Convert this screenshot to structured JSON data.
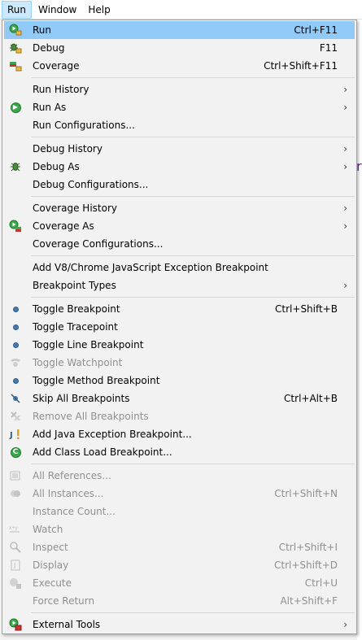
{
  "menubar": {
    "items": [
      {
        "label": "Run"
      },
      {
        "label": "Window"
      },
      {
        "label": "Help"
      }
    ]
  },
  "run_menu": {
    "g1": [
      {
        "label": "Run",
        "accel": "Ctrl+F11",
        "icon": "run-icon"
      },
      {
        "label": "Debug",
        "accel": "F11",
        "icon": "debug-icon"
      },
      {
        "label": "Coverage",
        "accel": "Ctrl+Shift+F11",
        "icon": "coverage-icon"
      }
    ],
    "g2": [
      {
        "label": "Run History"
      },
      {
        "label": "Run As",
        "icon": "run-as-icon"
      },
      {
        "label": "Run Configurations..."
      }
    ],
    "g3": [
      {
        "label": "Debug History"
      },
      {
        "label": "Debug As",
        "icon": "debug-as-icon"
      },
      {
        "label": "Debug Configurations..."
      }
    ],
    "g4": [
      {
        "label": "Coverage History"
      },
      {
        "label": "Coverage As",
        "icon": "coverage-as-icon"
      },
      {
        "label": "Coverage Configurations..."
      }
    ],
    "g5": [
      {
        "label": "Add V8/Chrome JavaScript Exception Breakpoint"
      },
      {
        "label": "Breakpoint Types"
      }
    ],
    "g6": [
      {
        "label": "Toggle Breakpoint",
        "accel": "Ctrl+Shift+B"
      },
      {
        "label": "Toggle Tracepoint"
      },
      {
        "label": "Toggle Line Breakpoint"
      },
      {
        "label": "Toggle Watchpoint"
      },
      {
        "label": "Toggle Method Breakpoint"
      },
      {
        "label": "Skip All Breakpoints",
        "accel": "Ctrl+Alt+B"
      },
      {
        "label": "Remove All Breakpoints"
      },
      {
        "label": "Add Java Exception Breakpoint..."
      },
      {
        "label": "Add Class Load Breakpoint..."
      }
    ],
    "g7": [
      {
        "label": "All References..."
      },
      {
        "label": "All Instances...",
        "accel": "Ctrl+Shift+N"
      },
      {
        "label": "Instance Count..."
      },
      {
        "label": "Watch"
      },
      {
        "label": "Inspect",
        "accel": "Ctrl+Shift+I"
      },
      {
        "label": "Display",
        "accel": "Ctrl+Shift+D"
      },
      {
        "label": "Execute",
        "accel": "Ctrl+U"
      },
      {
        "label": "Force Return",
        "accel": "Alt+Shift+F"
      }
    ],
    "g8": [
      {
        "label": "External Tools"
      }
    ]
  },
  "colors": {
    "highlight": "#91c9f7",
    "menubar_active": "#cce8ff"
  }
}
